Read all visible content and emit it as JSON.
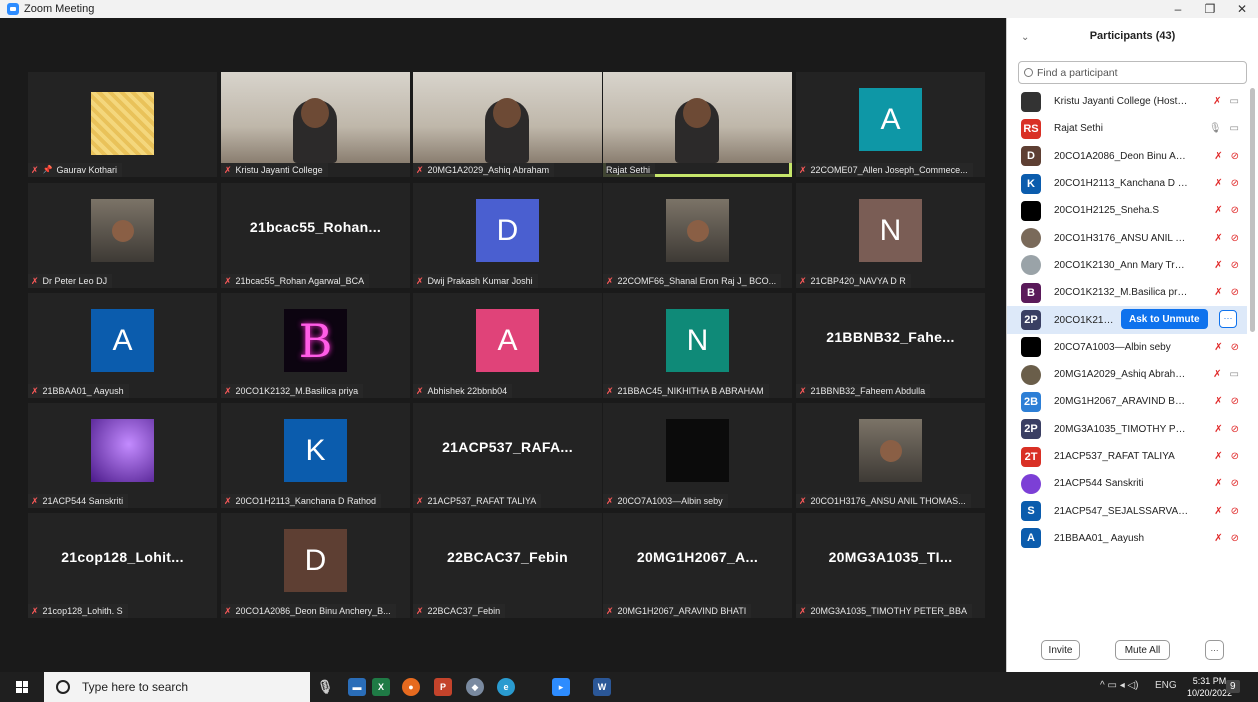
{
  "window": {
    "title": "Zoom Meeting",
    "controls": [
      "–",
      "❐",
      "✕"
    ]
  },
  "tiles": [
    {
      "name": "Gaurav Kothari",
      "type": "pattern",
      "pinned": true
    },
    {
      "name": "Kristu Jayanti College",
      "type": "video"
    },
    {
      "name": "20MG1A2029_Ashiq Abraham",
      "type": "video"
    },
    {
      "name": "Rajat Sethi",
      "type": "video",
      "active": true
    },
    {
      "name": "22COME07_Allen Joseph_Commece...",
      "type": "letter",
      "letter": "A",
      "color": "#0e97a6"
    },
    {
      "name": "Dr Peter Leo DJ",
      "type": "photo"
    },
    {
      "name": "21bcac55_Rohan Agarwal_BCA",
      "type": "text",
      "big": "21bcac55_Rohan..."
    },
    {
      "name": "Dwij Prakash Kumar Joshi",
      "type": "letter",
      "letter": "D",
      "color": "#4a5fd0"
    },
    {
      "name": "22COMF66_Shanal Eron Raj J_ BCO...",
      "type": "photo"
    },
    {
      "name": "21CBP420_NAVYA D R",
      "type": "letter",
      "letter": "N",
      "color": "#7a5d55"
    },
    {
      "name": "21BBAA01_ Aayush",
      "type": "letter",
      "letter": "A",
      "color": "#0b5cad"
    },
    {
      "name": "20CO1K2132_M.Basilica priya",
      "type": "neon"
    },
    {
      "name": "Abhishek 22bbnb04",
      "type": "letter",
      "letter": "A",
      "color": "#e04379"
    },
    {
      "name": "21BBAC45_NIKHITHA B ABRAHAM",
      "type": "letter",
      "letter": "N",
      "color": "#0f8a78"
    },
    {
      "name": "21BBNB32_Faheem Abdulla",
      "type": "text",
      "big": "21BBNB32_Fahe..."
    },
    {
      "name": "21ACP544 Sanskriti",
      "type": "purple"
    },
    {
      "name": "20CO1H2113_Kanchana D Rathod",
      "type": "letter",
      "letter": "K",
      "color": "#0b5cad"
    },
    {
      "name": "21ACP537_RAFAT TALIYA",
      "type": "text",
      "big": "21ACP537_RAFA..."
    },
    {
      "name": "20CO7A1003—Albin seby",
      "type": "dark"
    },
    {
      "name": "20CO1H3176_ANSU ANIL THOMAS...",
      "type": "photo"
    },
    {
      "name": "21cop128_Lohith. S",
      "type": "text",
      "big": "21cop128_Lohit..."
    },
    {
      "name": "20CO1A2086_Deon Binu Anchery_B...",
      "type": "letter",
      "letter": "D",
      "color": "#5e3f33"
    },
    {
      "name": "22BCAC37_Febin",
      "type": "text",
      "big": "22BCAC37_Febin"
    },
    {
      "name": "20MG1H2067_ARAVIND BHATI",
      "type": "text",
      "big": "20MG1H2067_A..."
    },
    {
      "name": "20MG3A1035_TIMOTHY PETER_BBA",
      "type": "text",
      "big": "20MG3A1035_TI..."
    }
  ],
  "panel": {
    "title": "Participants (43)",
    "search_placeholder": "Find a participant",
    "ask_unmute": "Ask to Unmute",
    "more": "···",
    "invite": "Invite",
    "mute_all": "Mute All",
    "footer_more": "···",
    "participants": [
      {
        "name": "Kristu Jayanti College (Host, me)",
        "av": "",
        "color": "#333333",
        "kind": "img-dark",
        "mic": "muted",
        "video": "gray"
      },
      {
        "name": "Rajat Sethi",
        "av": "RS",
        "color": "#d93025",
        "mic": "on",
        "video": "gray"
      },
      {
        "name": "20CO1A2086_Deon Binu Anche...",
        "av": "D",
        "color": "#5e3f33",
        "mic": "muted",
        "video": "off"
      },
      {
        "name": "20CO1H2113_Kanchana D Rath...",
        "av": "K",
        "color": "#0b5cad",
        "mic": "muted",
        "video": "off"
      },
      {
        "name": "20CO1H2125_Sneha.S",
        "av": "",
        "color": "#000000",
        "mic": "muted",
        "video": "off"
      },
      {
        "name": "20CO1H3176_ANSU ANIL THO...",
        "av": "",
        "color": "#7a6a5a",
        "kind": "round",
        "mic": "muted",
        "video": "off"
      },
      {
        "name": "20CO1K2130_Ann Mary Tresa_...",
        "av": "",
        "color": "#9aa3a8",
        "kind": "round",
        "mic": "muted",
        "video": "off"
      },
      {
        "name": "20CO1K2132_M.Basilica priya",
        "av": "B",
        "color": "#5a1a5a",
        "mic": "muted",
        "video": "off"
      },
      {
        "name": "20CO1K2143_Pr",
        "av": "2P",
        "color": "#3a3f63",
        "highlight": true
      },
      {
        "name": "20CO7A1003—Albin seby",
        "av": "",
        "color": "#000000",
        "mic": "muted",
        "video": "off"
      },
      {
        "name": "20MG1A2029_Ashiq Abraham",
        "av": "",
        "color": "#6a5e4a",
        "kind": "round",
        "mic": "muted",
        "video": "gray"
      },
      {
        "name": "20MG1H2067_ARAVIND BHATI",
        "av": "2B",
        "color": "#2d7fd6",
        "mic": "muted",
        "video": "off"
      },
      {
        "name": "20MG3A1035_TIMOTHY PETER_...",
        "av": "2P",
        "color": "#3a3f63",
        "mic": "muted",
        "video": "off"
      },
      {
        "name": "21ACP537_RAFAT TALIYA",
        "av": "2T",
        "color": "#d93025",
        "mic": "muted",
        "video": "off"
      },
      {
        "name": "21ACP544 Sanskriti",
        "av": "",
        "color": "#7c3fd6",
        "kind": "round",
        "mic": "muted",
        "video": "off"
      },
      {
        "name": "21ACP547_SEJALSSARVADE",
        "av": "S",
        "color": "#0b5cad",
        "mic": "muted",
        "video": "off"
      },
      {
        "name": "21BBAA01_ Aayush",
        "av": "A",
        "color": "#0b5cad",
        "mic": "muted",
        "video": "off"
      }
    ]
  },
  "taskbar": {
    "search_placeholder": "Type here to search",
    "language": "ENG",
    "time": "5:31 PM",
    "date": "10/20/2022",
    "notifications": "9"
  }
}
